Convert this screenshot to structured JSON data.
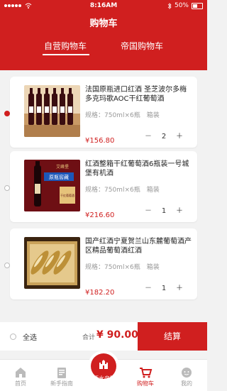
{
  "status_bar": {
    "time": "8:16AM",
    "battery": "50%"
  },
  "header": {
    "title": "购物车"
  },
  "tabs": [
    {
      "label": "自营购物车"
    },
    {
      "label": "帝国购物车"
    }
  ],
  "items": [
    {
      "name": "法国原瓶进口红酒 圣芝波尔多梅多克玛歌AOC干红葡萄酒",
      "spec": "规格：750ml×6瓶　箱装",
      "price": "¥156.80",
      "qty": "2",
      "minus": "－",
      "plus": "＋",
      "selected": true
    },
    {
      "name": "红酒整箱干红葡萄酒6瓶装一号城堡有机酒",
      "spec": "规格：750ml×6瓶　箱装",
      "price": "¥216.60",
      "qty": "1",
      "minus": "－",
      "plus": "＋",
      "selected": false
    },
    {
      "name": "国产红酒宁夏贺兰山东麓葡萄酒产区精品葡萄酒红酒",
      "spec": "规格：750ml×6瓶　箱装",
      "price": "¥182.20",
      "qty": "1",
      "minus": "－",
      "plus": "＋",
      "selected": false
    }
  ],
  "thumb_labels": {
    "item2_badge": "艾峰堡",
    "item2_banner": "原瓶窖藏",
    "item2_side": "干红葡萄酒"
  },
  "checkout": {
    "select_all_label": "全选",
    "total_label": "合计",
    "total_value": "¥ 90.00",
    "settle_label": "结算"
  },
  "bottom_nav": [
    {
      "label": "首页",
      "icon": "home-icon",
      "active": false
    },
    {
      "label": "新手指南",
      "icon": "guide-icon",
      "active": false
    },
    {
      "label": "酒水帝国",
      "icon": "castle-icon",
      "active": false
    },
    {
      "label": "购物车",
      "icon": "cart-icon",
      "active": true
    },
    {
      "label": "我的",
      "icon": "profile-icon",
      "active": false
    }
  ],
  "colors": {
    "brand": "#d01f1f",
    "background": "#f2f2f2"
  }
}
